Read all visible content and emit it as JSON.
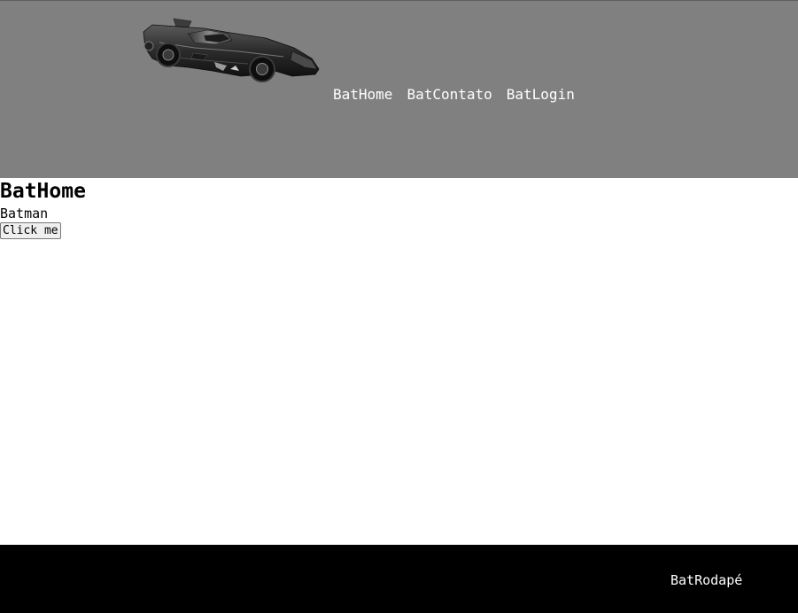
{
  "header": {
    "logo_icon": "batmobile-car-image",
    "nav": [
      {
        "label": "BatHome"
      },
      {
        "label": "BatContato"
      },
      {
        "label": "BatLogin"
      }
    ]
  },
  "main": {
    "title": "BatHome",
    "text": "Batman",
    "button_label": "Click me"
  },
  "footer": {
    "text": "BatRodapé"
  },
  "colors": {
    "header_bg": "#808080",
    "footer_bg": "#000000",
    "nav_text": "#ffffff",
    "body_bg": "#ffffff"
  }
}
